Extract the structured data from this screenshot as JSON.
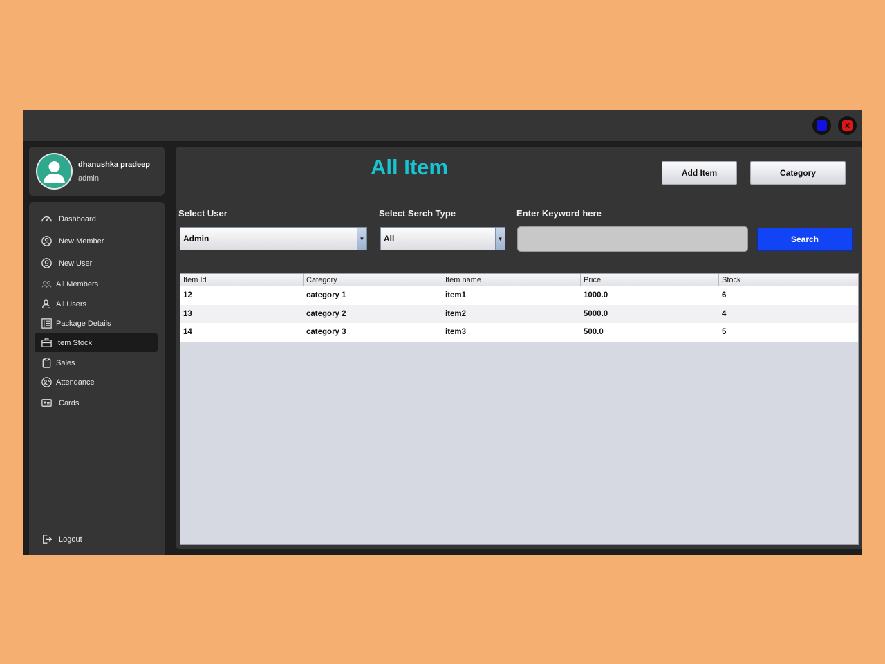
{
  "window": {
    "controls": [
      {
        "name": "minimize",
        "color": "#1212e0"
      },
      {
        "name": "close",
        "color": "#e01515"
      }
    ]
  },
  "profile": {
    "name": "dhanushka pradeep",
    "role": "admin",
    "avatar_icon": "user-avatar-icon"
  },
  "sidebar": {
    "items": [
      {
        "label": "Dashboard",
        "icon": "dashboard-gauge-icon",
        "active": false
      },
      {
        "label": "New Member",
        "icon": "member-add-icon",
        "active": false
      },
      {
        "label": "New User",
        "icon": "user-circle-icon",
        "active": false
      },
      {
        "label": "All Members",
        "icon": "group-icon",
        "active": false
      },
      {
        "label": "All Users",
        "icon": "users-icon",
        "active": false
      },
      {
        "label": "Package Details",
        "icon": "list-details-icon",
        "active": false
      },
      {
        "label": "Item Stock",
        "icon": "briefcase-icon",
        "active": true
      },
      {
        "label": "Sales",
        "icon": "clipboard-icon",
        "active": false
      },
      {
        "label": "Attendance",
        "icon": "attendance-icon",
        "active": false
      },
      {
        "label": "Cards",
        "icon": "card-icon",
        "active": false
      }
    ],
    "logout": {
      "label": "Logout",
      "icon": "logout-icon"
    }
  },
  "main": {
    "title": "All Item",
    "title_color": "#18c4d2",
    "buttons": {
      "add_item": "Add Item",
      "category": "Category"
    },
    "filters": {
      "user_label": "Select User",
      "user_value": "Admin",
      "type_label": "Select Serch Type",
      "type_value": "All",
      "keyword_label": "Enter Keyword here",
      "keyword_value": "",
      "search_button": "Search",
      "search_color": "#1144f5"
    },
    "table": {
      "columns": [
        "Item Id",
        "Category",
        "Item name",
        "Price",
        "Stock"
      ],
      "rows": [
        [
          "12",
          "category 1",
          "item1",
          "1000.0",
          "6"
        ],
        [
          "13",
          "category 2",
          "item2",
          "5000.0",
          "4"
        ],
        [
          "14",
          "category 3",
          "item3",
          "500.0",
          "5"
        ]
      ]
    }
  }
}
